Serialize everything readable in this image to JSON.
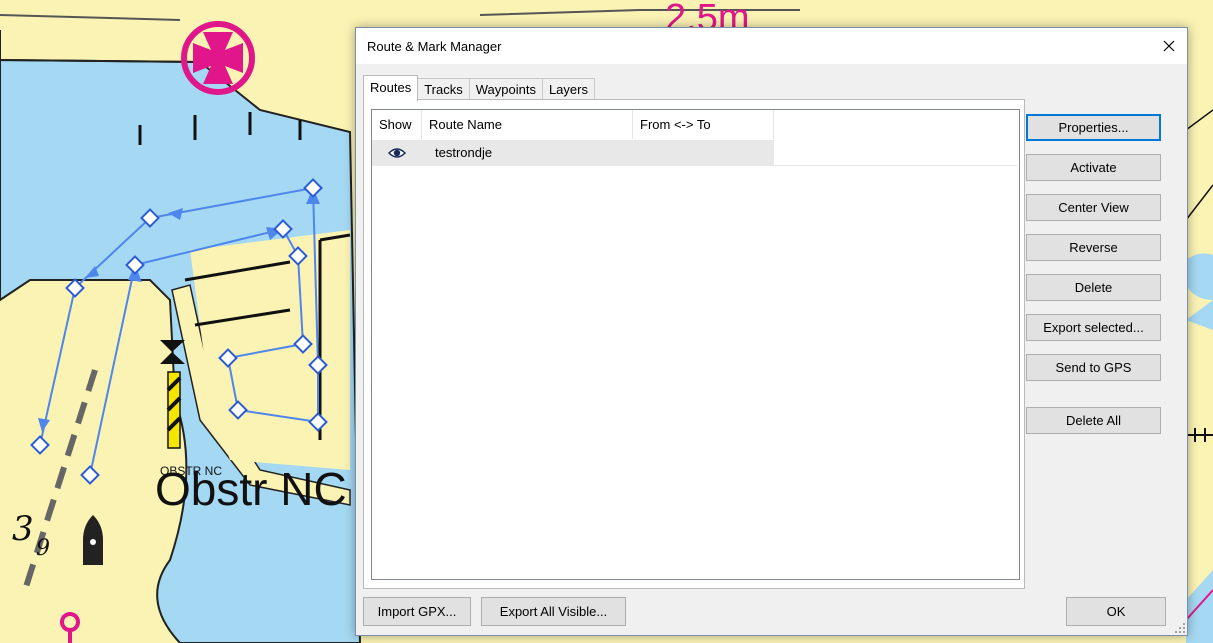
{
  "chart": {
    "depth_label": "3",
    "depth_subscript": "9",
    "obstruction_label": "Obstr NC",
    "obstruction_small_label": "OBSTR NC",
    "top_label": "2.5m"
  },
  "dialog": {
    "title": "Route & Mark Manager",
    "tabs": [
      {
        "label": "Routes",
        "active": true
      },
      {
        "label": "Tracks",
        "active": false
      },
      {
        "label": "Waypoints",
        "active": false
      },
      {
        "label": "Layers",
        "active": false
      }
    ],
    "columns": [
      "Show",
      "Route Name",
      "From <-> To"
    ],
    "routes": [
      {
        "show_icon": "eye-icon",
        "name": "testrondje",
        "from_to": ""
      }
    ],
    "side_buttons": {
      "properties": "Properties...",
      "activate": "Activate",
      "center_view": "Center View",
      "reverse": "Reverse",
      "delete": "Delete",
      "export_selected": "Export selected...",
      "send_to_gps": "Send to GPS",
      "delete_all": "Delete All"
    },
    "bottom_buttons": {
      "import_gpx": "Import GPX...",
      "export_all_visible": "Export All Visible...",
      "ok": "OK"
    }
  },
  "colors": {
    "land": "#fbf3b4",
    "water": "#a5d8f2",
    "route": "#4f86ec",
    "magenta": "#e0168a"
  }
}
